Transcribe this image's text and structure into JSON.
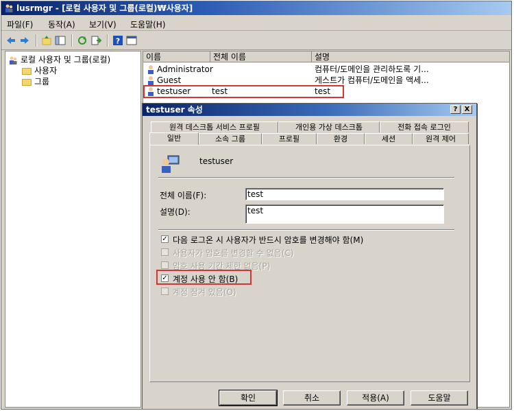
{
  "window": {
    "title": "lusrmgr - [로컬 사용자 및 그룹(로컬)₩사용자]"
  },
  "menu": {
    "items": [
      "파일(F)",
      "동작(A)",
      "보기(V)",
      "도움말(H)"
    ]
  },
  "tree": {
    "root": "로컬 사용자 및 그룹(로컬)",
    "children": [
      "사용자",
      "그룹"
    ]
  },
  "list": {
    "columns": [
      "이름",
      "전체 이름",
      "설명"
    ],
    "rows": [
      {
        "name": "Administrator",
        "fullname": "",
        "desc": "컴퓨터/도메인을 관리하도록 기..."
      },
      {
        "name": "Guest",
        "fullname": "",
        "desc": "게스트가 컴퓨터/도메인을 액세..."
      },
      {
        "name": "testuser",
        "fullname": "test",
        "desc": "test"
      }
    ]
  },
  "dialog": {
    "title": "testuser 속성",
    "help_button": "?",
    "close_button": "X",
    "tabs_top": [
      "원격 데스크톱 서비스 프로필",
      "개인용 가상 데스크톱",
      "전화 접속 로그인"
    ],
    "tabs_bottom": [
      "일반",
      "소속 그룹",
      "프로필",
      "환경",
      "세션",
      "원격 제어"
    ],
    "username": "testuser",
    "fullname_label": "전체 이름(F):",
    "fullname_value": "test",
    "desc_label": "설명(D):",
    "desc_value": "test",
    "checkboxes": [
      {
        "label": "다음 로그온 시 사용자가 반드시 암호를 변경해야 함(M)",
        "checked": true,
        "enabled": true
      },
      {
        "label": "사용자가 암호를 변경할 수 없음(C)",
        "checked": false,
        "enabled": false
      },
      {
        "label": "암호 사용 기간 제한 없음(P)",
        "checked": false,
        "enabled": false
      },
      {
        "label": "계정 사용 안 함(B)",
        "checked": true,
        "enabled": true
      },
      {
        "label": "계정 잠겨 있음(O)",
        "checked": false,
        "enabled": false
      }
    ],
    "buttons": {
      "ok": "확인",
      "cancel": "취소",
      "apply": "적용(A)",
      "help": "도움말"
    }
  },
  "colors": {
    "title_start": "#0a246a",
    "title_end": "#a6caf0",
    "highlight": "#d73535"
  }
}
